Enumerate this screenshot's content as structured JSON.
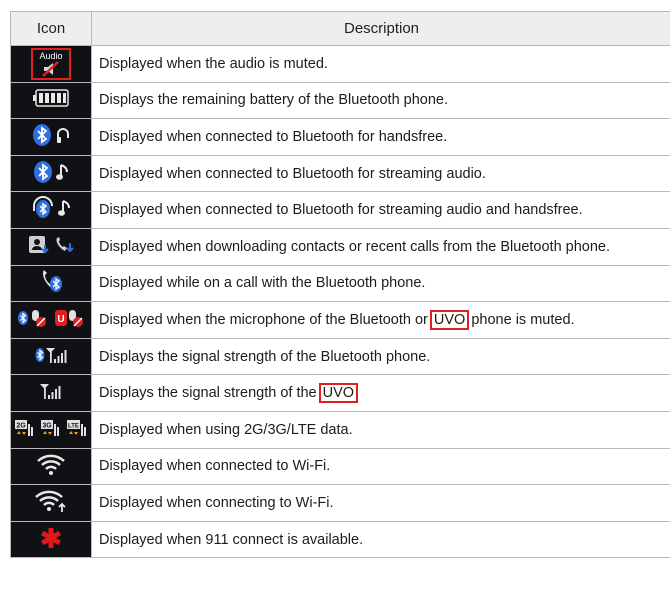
{
  "header": {
    "icon": "Icon",
    "description": "Description"
  },
  "rows": [
    {
      "icon": "audio-muted-icon",
      "icon_text": "Audio",
      "text": "Displayed when the audio is muted."
    },
    {
      "icon": "battery-icon",
      "text": "Displays the remaining battery of the Bluetooth phone."
    },
    {
      "icon": "bluetooth-handsfree-icon",
      "text": "Displayed when connected to Bluetooth for handsfree."
    },
    {
      "icon": "bluetooth-streaming-icon",
      "text": "Displayed when connected to Bluetooth for streaming audio."
    },
    {
      "icon": "bluetooth-streaming-handsfree-icon",
      "text": "Displayed when connected to Bluetooth for streaming audio and handsfree."
    },
    {
      "icon": "download-contacts-icon",
      "text": "Displayed when downloading contacts or recent calls from the Bluetooth phone."
    },
    {
      "icon": "bluetooth-call-icon",
      "text": "Displayed while on a call with the Bluetooth phone."
    },
    {
      "icon": "mic-muted-icon",
      "text_before": "Displayed when the microphone of the Bluetooth or ",
      "boxed": "UVO",
      "text_after": " phone is muted."
    },
    {
      "icon": "bluetooth-signal-icon",
      "text": "Displays the signal strength of the Bluetooth phone."
    },
    {
      "icon": "signal-strength-icon",
      "text_before": "Displays the signal strength of the ",
      "boxed": "UVO",
      "text_after": ""
    },
    {
      "icon": "data-2g-3g-lte-icon",
      "labels": [
        "2G",
        "3G",
        "LTE"
      ],
      "text": "Displayed when using 2G/3G/LTE data."
    },
    {
      "icon": "wifi-icon",
      "text": "Displayed when connected to Wi-Fi."
    },
    {
      "icon": "wifi-connecting-icon",
      "text": "Displayed when connecting to Wi-Fi."
    },
    {
      "icon": "emergency-911-icon",
      "text": "Displayed when 911 connect is available."
    }
  ],
  "colors": {
    "icon_bg": "#0f1115",
    "bluetooth": "#2f6fe0",
    "highlight": "#e02020",
    "header_bg": "#eeeeee"
  }
}
